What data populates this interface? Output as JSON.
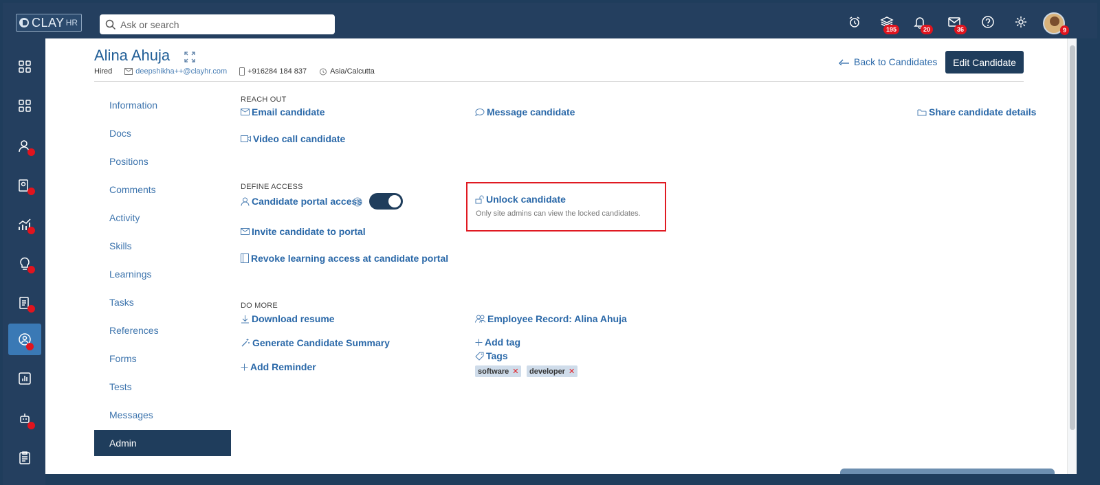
{
  "brand": {
    "name": "CLAY",
    "sub": "HR"
  },
  "search": {
    "placeholder": "Ask or search"
  },
  "topbar": {
    "badges": {
      "learning": "195",
      "notifications": "20",
      "messages": "36",
      "avatar": "9"
    }
  },
  "candidate": {
    "name": "Alina Ahuja",
    "status": "Hired",
    "email": "deepshikha++@clayhr.com",
    "phone": "+916284 184 837",
    "timezone": "Asia/Calcutta"
  },
  "header_actions": {
    "back": "Back to Candidates",
    "edit": "Edit Candidate"
  },
  "subnav": [
    "Information",
    "Docs",
    "Positions",
    "Comments",
    "Activity",
    "Skills",
    "Learnings",
    "Tasks",
    "References",
    "Forms",
    "Tests",
    "Messages",
    "Admin"
  ],
  "sections": {
    "reach_out": {
      "title": "REACH OUT",
      "email": "Email candidate",
      "message": "Message candidate",
      "share": "Share candidate details",
      "video": "Video call candidate"
    },
    "define_access": {
      "title": "DEFINE ACCESS",
      "portal_access": "Candidate portal access",
      "portal_access_enabled": true,
      "unlock": "Unlock candidate",
      "unlock_note": "Only site admins can view the locked candidates.",
      "invite": "Invite candidate to portal",
      "revoke": "Revoke learning access at candidate portal"
    },
    "do_more": {
      "title": "DO MORE",
      "download": "Download resume",
      "employee_record": "Employee Record: Alina Ahuja",
      "generate_summary": "Generate Candidate Summary",
      "add_tag": "Add tag",
      "tags_label": "Tags",
      "add_reminder": "Add Reminder",
      "tags": [
        "software",
        "developer"
      ]
    }
  }
}
